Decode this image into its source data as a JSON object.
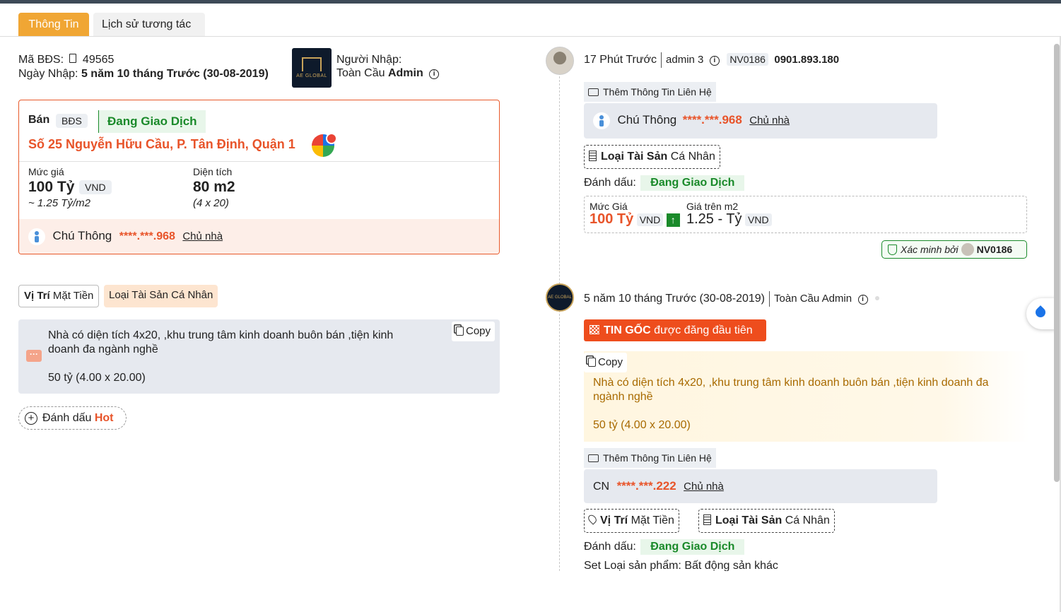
{
  "tabs": [
    {
      "label": "Thông Tin"
    },
    {
      "label": "Lịch sử tương tác"
    }
  ],
  "listing": {
    "code_label": "Mã BĐS:",
    "code": "49565",
    "date_label": "Ngày Nhập:",
    "date": "5 năm 10 tháng Trước (30-08-2019)",
    "importer_label": "Người Nhập:",
    "importer_org": "Toàn Cầu",
    "importer_name": "Admin",
    "logo_text": "AE GLOBAL"
  },
  "card": {
    "type": "Bán",
    "type_badge": "BĐS",
    "status": "Đang Giao Dịch",
    "address": "Số 25 Nguyễn Hữu Cầu, P. Tân Định, Quận 1",
    "price_label": "Mức giá",
    "price": "100 Tỷ",
    "price_unit": "VND",
    "price_per_m2": "~ 1.25 Tỷ/m2",
    "area_label": "Diện tích",
    "area": "80 m2",
    "dimensions": "(4 x 20)",
    "contact_name": "Chú Thông",
    "contact_phone": "****.***.968",
    "contact_role": "Chủ nhà"
  },
  "tags": {
    "position_label": "Vị Trí",
    "position_value": "Mặt Tiền",
    "asset_label": "Loại Tài Sản",
    "asset_value": "Cá Nhân"
  },
  "description": {
    "copy_label": "Copy",
    "line1": "Nhà có diện tích 4x20, ,khu trung tâm kinh doanh buôn bán ,tiện kinh",
    "line2": "doanh đa ngành nghề",
    "line3": "50 tỷ (4.00 x 20.00)"
  },
  "hot_button": {
    "label": "Đánh dấu",
    "hot": "Hot"
  },
  "timeline": [
    {
      "time": "17 Phút Trước",
      "user": "admin 3",
      "staff_code": "NV0186",
      "phone": "0901.893.180",
      "add_contact_label": "Thêm Thông Tin Liên Hệ",
      "contact_name": "Chú Thông",
      "contact_phone": "****.***.968",
      "contact_role": "Chủ nhà",
      "asset_label": "Loại Tài Sản",
      "asset_value": "Cá Nhân",
      "mark_label": "Đánh dấu:",
      "mark_value": "Đang Giao Dịch",
      "price_label": "Mức Giá",
      "price": "100 Tỷ",
      "price_unit": "VND",
      "per_m2_label": "Giá trên m2",
      "per_m2": "1.25 - Tỷ",
      "per_m2_unit": "VND",
      "verified_label": "Xác minh bởi",
      "verified_by": "NV0186"
    },
    {
      "time": "5 năm 10 tháng Trước (30-08-2019)",
      "user": "Toàn Cầu Admin",
      "origin_strong": "TIN GỐC",
      "origin_rest": "được đăng đầu tiên",
      "copy_label": "Copy",
      "desc_line1": "Nhà có diện tích 4x20, ,khu trung tâm kinh doanh buôn bán ,tiện kinh doanh đa",
      "desc_line2": "ngành nghề",
      "desc_line3": "50 tỷ (4.00 x 20.00)",
      "add_contact_label": "Thêm Thông Tin Liên Hệ",
      "contact_name": "CN",
      "contact_phone": "****.***.222",
      "contact_role": "Chủ nhà",
      "position_label": "Vị Trí",
      "position_value": "Mặt Tiền",
      "asset_label": "Loại Tài Sản",
      "asset_value": "Cá Nhân",
      "mark_label": "Đánh dấu:",
      "mark_value": "Đang Giao Dịch",
      "product_label": "Set Loại sản phẩm:",
      "product_value": "Bất động sản khác"
    }
  ],
  "colors": {
    "accent_orange": "#f0a634",
    "address_red": "#e8542a",
    "status_green": "#1a8a2a",
    "origin_red": "#ee4d1d"
  }
}
